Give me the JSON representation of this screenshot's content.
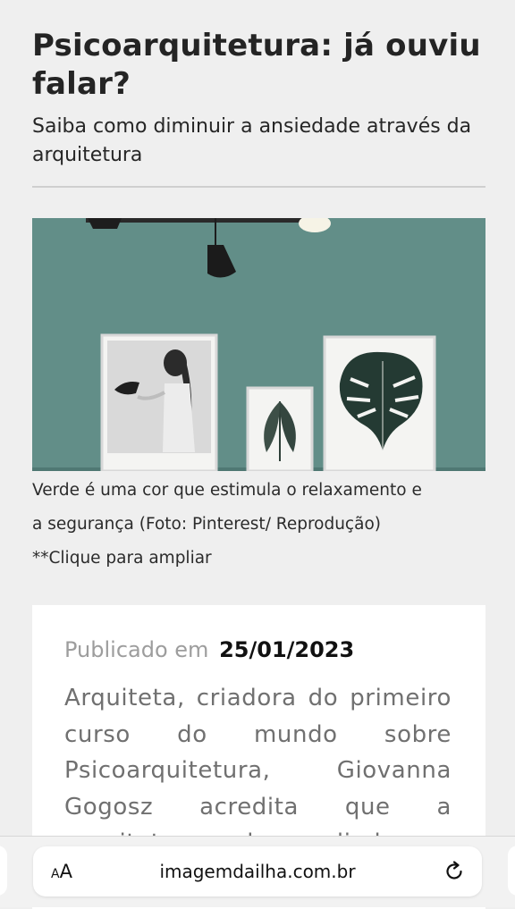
{
  "article": {
    "title": "Psicoarquitetura: já ouviu falar?",
    "subtitle": "Saiba como diminuir a ansiedade através da arquitetura"
  },
  "photo": {
    "wall_color": "#5e8a85"
  },
  "caption": {
    "line1": "Verde é uma cor que estimula o relaxamento e",
    "line2": "a segurança (Foto: Pinterest/ Reprodução)",
    "line3": "**Clique para ampliar"
  },
  "card": {
    "published_label": "Publicado em",
    "published_date": "25/01/2023",
    "body": "Arquiteta, criadora do primeiro curso do mundo sobre Psicoarquitetura, Giovanna Gogosz acredita que a arquitetura pode ser aliada"
  },
  "browser_bar": {
    "text_size_button": "AA",
    "url": "imagemdailha.com.br",
    "reload_icon": "reload-icon"
  }
}
